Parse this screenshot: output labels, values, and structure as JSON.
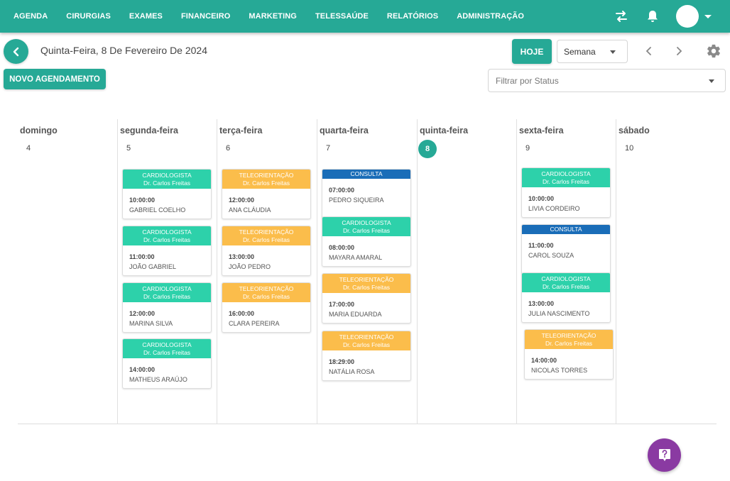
{
  "nav": {
    "items": [
      "AGENDA",
      "CIRURGIAS",
      "EXAMES",
      "FINANCEIRO",
      "MARKETING",
      "TELESSAÚDE",
      "RELATÓRIOS",
      "ADMINISTRAÇÃO"
    ],
    "icons": [
      "swap-icon",
      "bell-icon",
      "avatar",
      "chevron-down-icon"
    ]
  },
  "header": {
    "date_title": "Quinta-Feira, 8 De Fevereiro De 2024",
    "today_label": "HOJE",
    "view_select": "Semana",
    "new_label": "NOVO AGENDAMENTO",
    "status_placeholder": "Filtrar por Status"
  },
  "colors": {
    "primary": "#26a996",
    "cardiologista": "#2dd1aa",
    "teleorientacao": "#fbbd4b",
    "consulta": "#1a6db8",
    "help": "#8a3aa2"
  },
  "days": [
    {
      "name": "domingo",
      "num": "4",
      "appointments": []
    },
    {
      "name": "segunda-feira",
      "num": "5",
      "appointments": [
        {
          "type": "CARDIOLOGISTA",
          "doctor": "Dr. Carlos Freitas",
          "color": "green",
          "time": "10:00:00",
          "patient": "GABRIEL COELHO"
        },
        {
          "type": "CARDIOLOGISTA",
          "doctor": "Dr. Carlos Freitas",
          "color": "green",
          "time": "11:00:00",
          "patient": "JOÃO GABRIEL"
        },
        {
          "type": "CARDIOLOGISTA",
          "doctor": "Dr. Carlos Freitas",
          "color": "green",
          "time": "12:00:00",
          "patient": "MARINA SILVA"
        },
        {
          "type": "CARDIOLOGISTA",
          "doctor": "Dr. Carlos Freitas",
          "color": "green",
          "time": "14:00:00",
          "patient": "MATHEUS ARAÚJO"
        }
      ]
    },
    {
      "name": "terça-feira",
      "num": "6",
      "appointments": [
        {
          "type": "TELEORIENTAÇÃO",
          "doctor": "Dr. Carlos Freitas",
          "color": "orange",
          "time": "12:00:00",
          "patient": "ANA CLÁUDIA"
        },
        {
          "type": "TELEORIENTAÇÃO",
          "doctor": "Dr. Carlos Freitas",
          "color": "orange",
          "time": "13:00:00",
          "patient": "JOÃO PEDRO"
        },
        {
          "type": "TELEORIENTAÇÃO",
          "doctor": "Dr. Carlos Freitas",
          "color": "orange",
          "time": "16:00:00",
          "patient": "CLARA PEREIRA"
        }
      ]
    },
    {
      "name": "quarta-feira",
      "num": "7",
      "appointments": [
        {
          "type": "CONSULTA",
          "doctor": "",
          "color": "blue",
          "time": "07:00:00",
          "patient": "PEDRO SIQUEIRA"
        },
        {
          "type": "CARDIOLOGISTA",
          "doctor": "Dr. Carlos Freitas",
          "color": "green",
          "time": "08:00:00",
          "patient": "MAYARA AMARAL"
        },
        {
          "type": "TELEORIENTAÇÃO",
          "doctor": "Dr. Carlos Freitas",
          "color": "orange",
          "time": "17:00:00",
          "patient": "MARIA EDUARDA"
        },
        {
          "type": "TELEORIENTAÇÃO",
          "doctor": "Dr. Carlos Freitas",
          "color": "orange",
          "time": "18:29:00",
          "patient": "NATÁLIA ROSA"
        }
      ]
    },
    {
      "name": "quinta-feira",
      "num": "8",
      "today": true,
      "appointments": []
    },
    {
      "name": "sexta-feira",
      "num": "9",
      "appointments": [
        {
          "type": "CARDIOLOGISTA",
          "doctor": "Dr. Carlos Freitas",
          "color": "green",
          "time": "10:00:00",
          "patient": "LIVIA CORDEIRO"
        },
        {
          "type": "CONSULTA",
          "doctor": "",
          "color": "blue",
          "time": "11:00:00",
          "patient": "CAROL SOUZA"
        },
        {
          "type": "CARDIOLOGISTA",
          "doctor": "Dr. Carlos Freitas",
          "color": "green",
          "time": "13:00:00",
          "patient": "JULIA NASCIMENTO"
        },
        {
          "type": "TELEORIENTAÇÃO",
          "doctor": "Dr. Carlos Freitas",
          "color": "orange",
          "time": "14:00:00",
          "patient": "NICOLAS TORRES"
        }
      ]
    },
    {
      "name": "sábado",
      "num": "10",
      "appointments": []
    }
  ]
}
